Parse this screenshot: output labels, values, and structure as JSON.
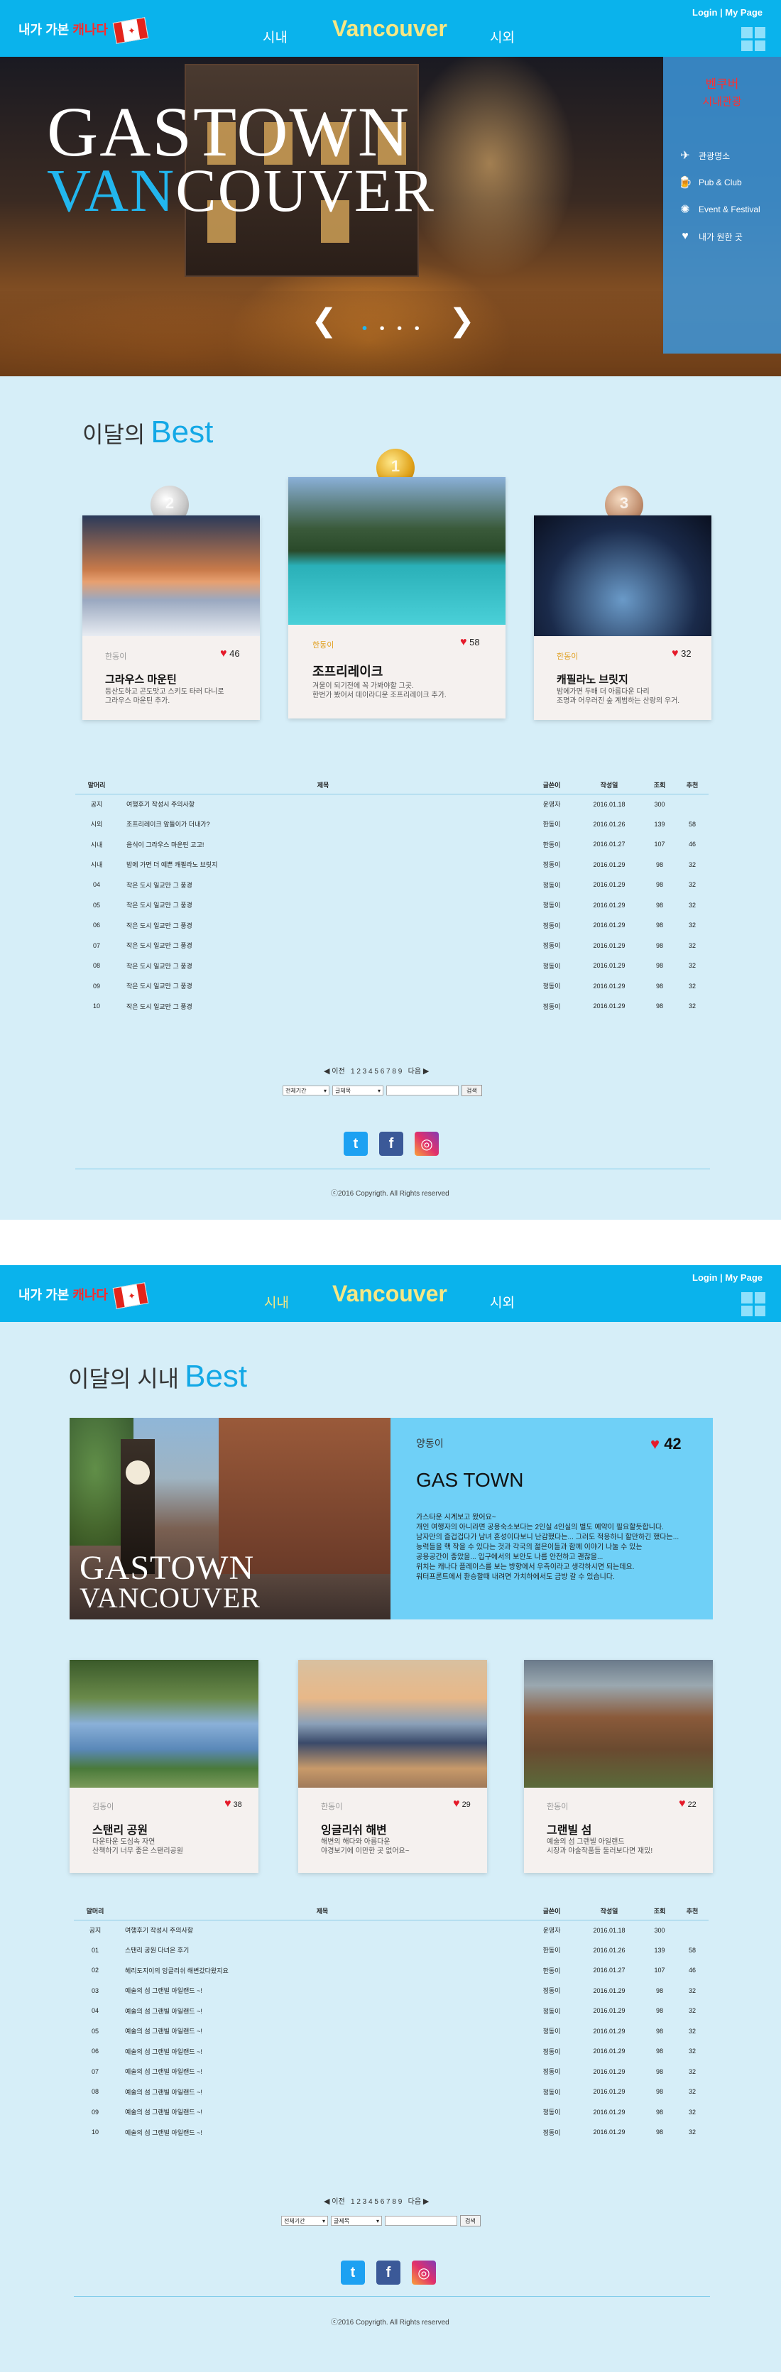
{
  "header": {
    "logo_text": "내가 가본",
    "logo_highlight": "캐나다",
    "nav_left": "시내",
    "brand": "Vancouver",
    "nav_right": "시외",
    "login": "Login | My Page"
  },
  "hero": {
    "title_line1": "GASTOWN",
    "title_line2a": "VAN",
    "title_line2b": "COUVER",
    "prev": "❮",
    "next": "❯",
    "dots_active": "•",
    "dots_rest": "• • •"
  },
  "side_panel": {
    "city": "벤쿠버",
    "subtitle": "시내관광",
    "items": [
      {
        "label": "관광명소",
        "icon": "airplane-icon",
        "glyph": "✈"
      },
      {
        "label": "Pub & Club",
        "icon": "beer-icon",
        "glyph": "🍺"
      },
      {
        "label": "Event & Festival",
        "icon": "firework-icon",
        "glyph": "✺"
      },
      {
        "label": "내가 원한 곳",
        "icon": "heart-icon",
        "glyph": "♥"
      }
    ]
  },
  "best": {
    "title": "이달의",
    "title_accent": "Best",
    "cards": [
      {
        "user": "한동이",
        "likes": "46",
        "name": "그라우스 마운틴",
        "desc": "등산도하고 곤도맛고 스키도 타러 다니로\n그라우스 마운틴 추가.",
        "medal": "2"
      },
      {
        "user": "한동이",
        "likes": "58",
        "name": "조프리레이크",
        "desc": "겨울이 되기전에 꼭 가봐야할 그곳.\n한번가 봤어서 데이라디운 조프리레이크 추가.",
        "medal": "1"
      },
      {
        "user": "한동이",
        "likes": "32",
        "name": "캐필라노 브릿지",
        "desc": "밤에가면 두배 더 아름다운 다리\n조명과 어우러진 숲 계범하는 산랑의 우거.",
        "medal": "3"
      }
    ]
  },
  "board1": {
    "headers": [
      "말머리",
      "제목",
      "글쓴이",
      "작성일",
      "조회",
      "추천"
    ],
    "rows": [
      [
        "공지",
        "여행후기 작성시 주의사항",
        "운영자",
        "2016.01.18",
        "300",
        ""
      ],
      [
        "시외",
        "조프리레이크 앞들이가 더내가?",
        "한동이",
        "2016.01.26",
        "139",
        "58"
      ],
      [
        "시내",
        "음식이 그라우스 마운틴 고고!",
        "한동이",
        "2016.01.27",
        "107",
        "46"
      ],
      [
        "시내",
        "밤에 가면 더 예쁜 캐필라노 브릿지",
        "정동이",
        "2016.01.29",
        "98",
        "32"
      ],
      [
        "04",
        "작은 도시 일교만 그 풍경",
        "정동이",
        "2016.01.29",
        "98",
        "32"
      ],
      [
        "05",
        "작은 도시 일교만 그 풍경",
        "정동이",
        "2016.01.29",
        "98",
        "32"
      ],
      [
        "06",
        "작은 도시 일교만 그 풍경",
        "정동이",
        "2016.01.29",
        "98",
        "32"
      ],
      [
        "07",
        "작은 도시 일교만 그 풍경",
        "정동이",
        "2016.01.29",
        "98",
        "32"
      ],
      [
        "08",
        "작은 도시 일교만 그 풍경",
        "정동이",
        "2016.01.29",
        "98",
        "32"
      ],
      [
        "09",
        "작은 도시 일교만 그 풍경",
        "정동이",
        "2016.01.29",
        "98",
        "32"
      ],
      [
        "10",
        "작은 도시 일교만 그 풍경",
        "정동이",
        "2016.01.29",
        "98",
        "32"
      ]
    ]
  },
  "pager": {
    "prev": "이전",
    "pages": "1 2 3 4 5 6 7 8 9",
    "next": "다음"
  },
  "search": {
    "select1": "전체기간",
    "select2": "글제목",
    "button": "검색"
  },
  "footer": {
    "copyright": "ⓒ2016 Copyrigth. All Rights reserved"
  },
  "page2": {
    "header": {
      "nav_left": "시내"
    },
    "title": "이달의 시내",
    "title_accent": "Best",
    "featured": {
      "user": "양동이",
      "likes": "42",
      "name": "GAS TOWN",
      "img_line1": "GASTOWN",
      "img_line2": "VANCOUVER",
      "desc": "가스타운 시계보고 왔어요~\n개인 여행자의 아니라면 공용숙소보다는 2인실 4인실의 별도 예약이 필요할듯합니다.\n 남자만의 즐겁겁다가 남녀 혼성이다보니 난감했다는... 그러도 적응하니 할만하긴 했다는...\n능력들을 핵 작을 수 있다는 것과 각국의 젊은이들과 함께 이야기 나눌 수 있는\n공용공간이 좋았을... 입구에서의 보안도 나름 안전하고 괜찮을...\n위치는 캐나다 플레이스를 보는 방향에서 우측이라고 생각하시면 되는데요.\n워터프론트에서 환승할때 내려면 가치하에서도 금방 갈 수 있습니다."
    },
    "cards": [
      {
        "user": "김동이",
        "likes": "38",
        "name": "스탠리 공원",
        "desc": "다운타운 도심속 자연\n산책하기 너무 좋은 스탠리공원"
      },
      {
        "user": "한동이",
        "likes": "29",
        "name": "잉글리쉬 해변",
        "desc": "해변의 해다와 아름다운\n야경보기에 이만한 곳 없어요~"
      },
      {
        "user": "한동이",
        "likes": "22",
        "name": "그랜빌 섬",
        "desc": "예술의 섬 그랜빌 아일랜드\n시장과 야술작품들 둘러보다면 재밌!"
      }
    ],
    "board": {
      "rows": [
        [
          "공지",
          "여행후기 작성시 주의사항",
          "운영자",
          "2016.01.18",
          "300",
          ""
        ],
        [
          "01",
          "스탠리 공원 다녀온 후기",
          "한동이",
          "2016.01.26",
          "139",
          "58"
        ],
        [
          "02",
          "헤리도지이의 잉글리쉬 해변갔다왔지요",
          "한동이",
          "2016.01.27",
          "107",
          "46"
        ],
        [
          "03",
          "예술의 섬 그랜빌 아일랜드 ~!",
          "정동이",
          "2016.01.29",
          "98",
          "32"
        ],
        [
          "04",
          "예술의 섬 그랜빌 아일랜드 ~!",
          "정동이",
          "2016.01.29",
          "98",
          "32"
        ],
        [
          "05",
          "예술의 섬 그랜빌 아일랜드 ~!",
          "정동이",
          "2016.01.29",
          "98",
          "32"
        ],
        [
          "06",
          "예술의 섬 그랜빌 아일랜드 ~!",
          "정동이",
          "2016.01.29",
          "98",
          "32"
        ],
        [
          "07",
          "예술의 섬 그랜빌 아일랜드 ~!",
          "정동이",
          "2016.01.29",
          "98",
          "32"
        ],
        [
          "08",
          "예술의 섬 그랜빌 아일랜드 ~!",
          "정동이",
          "2016.01.29",
          "98",
          "32"
        ],
        [
          "09",
          "예술의 섬 그랜빌 아일랜드 ~!",
          "정동이",
          "2016.01.29",
          "98",
          "32"
        ],
        [
          "10",
          "예술의 섬 그랜빌 아일랜드 ~!",
          "정동이",
          "2016.01.29",
          "98",
          "32"
        ]
      ]
    }
  },
  "colors": {
    "header": "#0ab3ec",
    "page_bg": "#d6eef8",
    "accent": "#13a8e6",
    "heart": "#e51a2a",
    "brand": "#f6e784"
  }
}
